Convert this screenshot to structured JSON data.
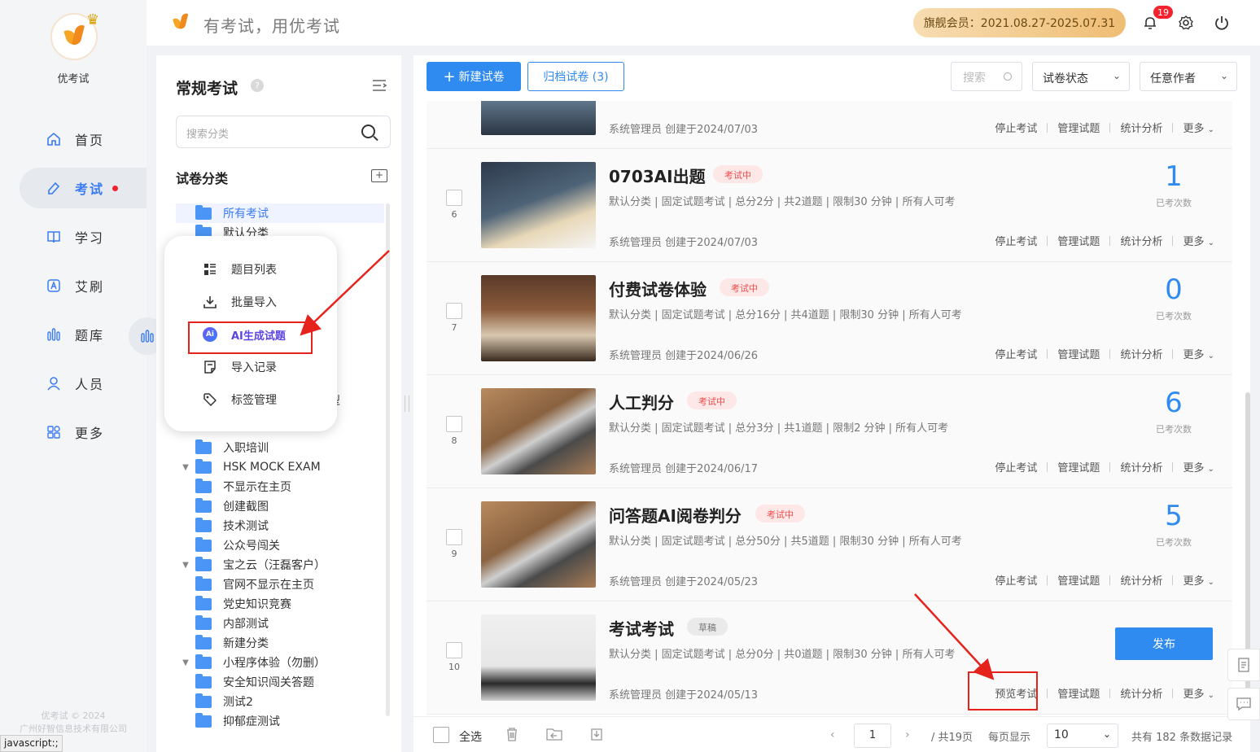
{
  "app": {
    "name": "优考试",
    "slogan": "有考试，用优考试"
  },
  "nav": {
    "items": [
      {
        "label": "首页",
        "icon": "home-icon"
      },
      {
        "label": "考试",
        "icon": "exam-icon",
        "active": true,
        "dot": true
      },
      {
        "label": "学习",
        "icon": "book-icon"
      },
      {
        "label": "艾刷",
        "icon": "ai-brush-icon"
      },
      {
        "label": "题库",
        "icon": "bank-icon"
      },
      {
        "label": "人员",
        "icon": "user-icon"
      },
      {
        "label": "更多",
        "icon": "more-apps-icon"
      }
    ],
    "copyright_1": "优考试 © 2024",
    "copyright_2": "广州好智信息技术有限公司"
  },
  "status_bar": "javascript:;",
  "header": {
    "vip": "旗舰会员：2021.08.27-2025.07.31",
    "notification_count": "19"
  },
  "categories": {
    "title": "常规考试",
    "search_placeholder": "搜索分类",
    "subtitle": "试卷分类",
    "tree": [
      {
        "label": "所有考试",
        "selected": true
      },
      {
        "label": "默认分类"
      },
      {
        "label": "型"
      },
      {
        "label": "入职培训"
      },
      {
        "label": "HSK MOCK EXAM",
        "caret": true
      },
      {
        "label": "不显示在主页"
      },
      {
        "label": "创建截图"
      },
      {
        "label": "技术测试"
      },
      {
        "label": "公众号闯关"
      },
      {
        "label": "宝之云（汪磊客户）",
        "caret": true
      },
      {
        "label": "官网不显示在主页"
      },
      {
        "label": "党史知识竞赛"
      },
      {
        "label": "内部测试"
      },
      {
        "label": "新建分类"
      },
      {
        "label": "小程序体验（勿删）",
        "caret": true
      },
      {
        "label": "安全知识闯关答题"
      },
      {
        "label": "测试2"
      },
      {
        "label": "抑郁症测试"
      }
    ]
  },
  "popup": {
    "items": [
      {
        "label": "题目列表",
        "icon": "list-icon"
      },
      {
        "label": "批量导入",
        "icon": "download-icon"
      },
      {
        "label": "AI生成试题",
        "icon": "ai-icon"
      },
      {
        "label": "导入记录",
        "icon": "record-icon"
      },
      {
        "label": "标签管理",
        "icon": "tag-icon"
      }
    ]
  },
  "toolbar": {
    "new_label": "新建试卷",
    "archive_label": "归档试卷 (3)",
    "search_placeholder": "搜索",
    "status_filter": "试卷状态",
    "author_filter": "任意作者"
  },
  "exams": [
    {
      "index": "",
      "title": "",
      "tag": "",
      "meta": "",
      "creator": "系统管理员 创建于2024/07/03",
      "count": "",
      "count_label": "",
      "actions": [
        "停止考试",
        "管理试题",
        "统计分析",
        "更多"
      ]
    },
    {
      "index": "6",
      "title": "0703AI出题",
      "tag": "考试中",
      "meta": "默认分类 | 固定试题考试 | 总分2分 | 共2道题 | 限制30 分钟 | 所有人可考",
      "creator": "系统管理员 创建于2024/07/03",
      "count": "1",
      "count_label": "已考次数",
      "actions": [
        "停止考试",
        "管理试题",
        "统计分析",
        "更多"
      ]
    },
    {
      "index": "7",
      "title": "付费试卷体验",
      "tag": "考试中",
      "meta": "默认分类 | 固定试题考试 | 总分16分 | 共4道题 | 限制30 分钟 | 所有人可考",
      "creator": "系统管理员 创建于2024/06/26",
      "count": "0",
      "count_label": "已考次数",
      "actions": [
        "停止考试",
        "管理试题",
        "统计分析",
        "更多"
      ]
    },
    {
      "index": "8",
      "title": "人工判分",
      "tag": "考试中",
      "meta": "默认分类 | 固定试题考试 | 总分3分 | 共1道题 | 限制2 分钟 | 所有人可考",
      "creator": "系统管理员 创建于2024/06/17",
      "count": "6",
      "count_label": "已考次数",
      "actions": [
        "停止考试",
        "管理试题",
        "统计分析",
        "更多"
      ]
    },
    {
      "index": "9",
      "title": "问答题AI阅卷判分",
      "tag": "考试中",
      "meta": "默认分类 | 固定试题考试 | 总分50分 | 共5道题 | 限制30 分钟 | 所有人可考",
      "creator": "系统管理员 创建于2024/05/23",
      "count": "5",
      "count_label": "已考次数",
      "actions": [
        "停止考试",
        "管理试题",
        "统计分析",
        "更多"
      ]
    },
    {
      "index": "10",
      "title": "考试考试",
      "tag": "草稿",
      "meta": "默认分类 | 固定试题考试 | 总分0分 | 共0道题 | 限制30 分钟 | 所有人可考",
      "creator": "系统管理员 创建于2024/05/13",
      "publish": "发布",
      "actions": [
        "预览考试",
        "管理试题",
        "统计分析",
        "更多"
      ]
    }
  ],
  "footer": {
    "select_all": "全选",
    "page": "1",
    "total_pages": "/ 共19页",
    "per_page_label": "每页显示",
    "per_page": "10",
    "total": "共有 182 条数据记录"
  }
}
